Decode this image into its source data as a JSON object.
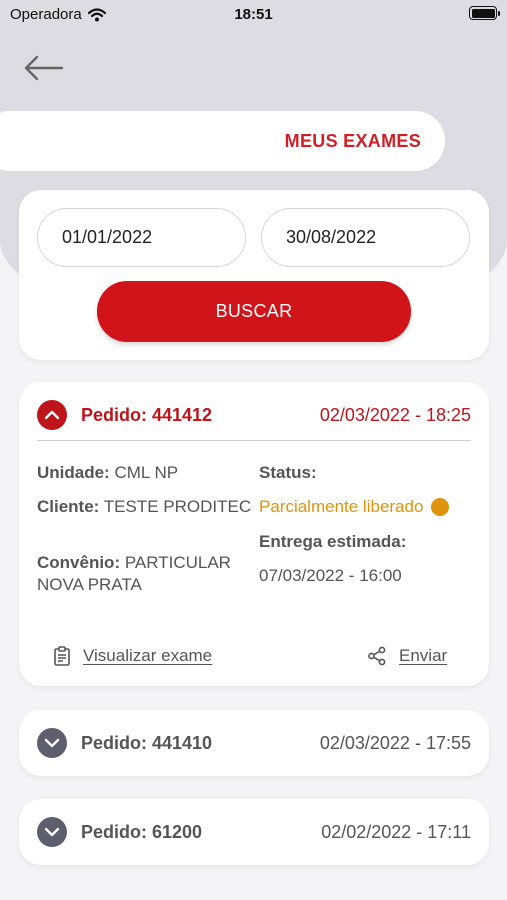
{
  "status_bar": {
    "carrier": "Operadora",
    "time": "18:51"
  },
  "header": {
    "title": "MEUS EXAMES"
  },
  "filter": {
    "date_from": "01/01/2022",
    "date_to": "30/08/2022",
    "search_label": "BUSCAR"
  },
  "orders": [
    {
      "number": "Pedido: 441412",
      "datetime": "02/03/2022 - 18:25",
      "expanded": true,
      "unidade_label": "Unidade:",
      "unidade": "CML NP",
      "cliente_label": "Cliente:",
      "cliente": "TESTE PRODITEC",
      "convenio_label": "Convênio:",
      "convenio": "PARTICULAR NOVA PRATA",
      "status_label": "Status:",
      "status": "Parcialmente liberado",
      "entrega_label": "Entrega estimada:",
      "entrega": "07/03/2022 - 16:00",
      "view_label": "Visualizar exame",
      "send_label": "Enviar"
    },
    {
      "number": "Pedido: 441410",
      "datetime": "02/03/2022 - 17:55",
      "expanded": false
    },
    {
      "number": "Pedido: 61200",
      "datetime": "02/02/2022 - 17:11",
      "expanded": false
    }
  ],
  "colors": {
    "accent": "#d11419",
    "status_partial": "#e0940c",
    "collapsed_toggle": "#5e5e6e",
    "background": "#f4f4f6"
  },
  "icons": [
    "wifi-icon",
    "battery-icon",
    "back-arrow-icon",
    "chevron-up-icon",
    "chevron-down-icon",
    "clipboard-icon",
    "share-icon"
  ]
}
